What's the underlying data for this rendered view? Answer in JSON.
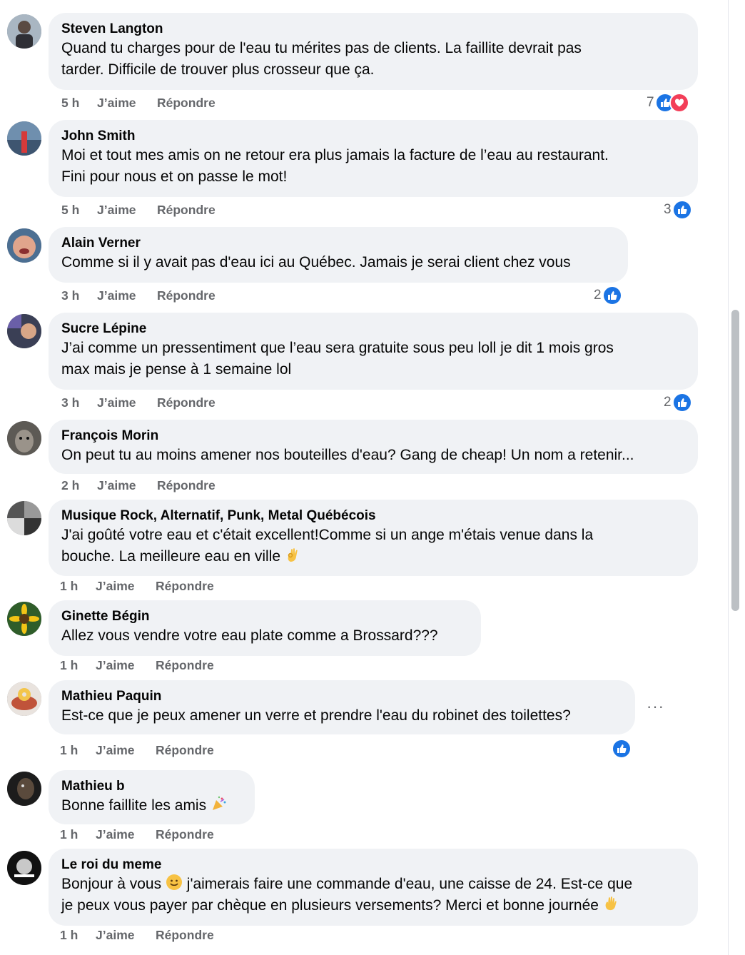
{
  "comments": [
    {
      "author": "Steven Langton",
      "lines": [
        "Quand tu charges pour de l'eau tu mérites pas de clients. La faillite devrait pas",
        "tarder. Difficile de trouver plus crosseur que ça."
      ],
      "time": "5 h",
      "like": "J’aime",
      "reply": "Répondre",
      "reaction_count": "7",
      "reactions": [
        "like",
        "love"
      ]
    },
    {
      "author": "John Smith",
      "lines": [
        "Moi et tout mes amis on ne retour era plus jamais la facture de l’eau au restaurant.",
        "Fini pour nous et on passe le mot!"
      ],
      "time": "5 h",
      "like": "J’aime",
      "reply": "Répondre",
      "reaction_count": "3",
      "reactions": [
        "like"
      ]
    },
    {
      "author": "Alain Verner",
      "lines": [
        "Comme si il y avait pas d'eau ici au Québec. Jamais je serai client chez vous"
      ],
      "time": "3 h",
      "like": "J’aime",
      "reply": "Répondre",
      "reaction_count": "2",
      "reactions": [
        "like"
      ]
    },
    {
      "author": "Sucre Lépine",
      "lines": [
        "J’ai comme un pressentiment que l’eau sera gratuite sous peu loll je dit 1 mois gros",
        "max mais je pense à 1 semaine lol"
      ],
      "time": "3 h",
      "like": "J’aime",
      "reply": "Répondre",
      "reaction_count": "2",
      "reactions": [
        "like"
      ]
    },
    {
      "author": "François Morin",
      "lines": [
        "On peut tu au moins amener nos bouteilles d'eau? Gang de cheap! Un nom a retenir..."
      ],
      "time": "2 h",
      "like": "J’aime",
      "reply": "Répondre",
      "reaction_count": "",
      "reactions": []
    },
    {
      "author": "Musique Rock, Alternatif, Punk, Metal Québécois",
      "lines": [
        "J'ai goûté votre eau et c'était excellent!Comme si un ange m'étais venue dans la",
        "bouche. La meilleure eau en ville"
      ],
      "time": "1 h",
      "like": "J’aime",
      "reply": "Répondre",
      "reaction_count": "",
      "reactions": []
    },
    {
      "author": "Ginette Bégin",
      "lines": [
        "Allez vous vendre votre eau plate comme a Brossard???"
      ],
      "time": "1 h",
      "like": "J’aime",
      "reply": "Répondre",
      "reaction_count": "",
      "reactions": []
    },
    {
      "author": "Mathieu Paquin",
      "lines": [
        "Est-ce que je peux amener un verre et prendre l'eau du robinet des toilettes?"
      ],
      "time": "1 h",
      "like": "J’aime",
      "reply": "Répondre",
      "reaction_count": "",
      "reactions": [
        "like"
      ],
      "more": "···"
    },
    {
      "author": "Mathieu b",
      "lines": [
        "Bonne faillite les amis"
      ],
      "time": "1 h",
      "like": "J’aime",
      "reply": "Répondre",
      "reaction_count": "",
      "reactions": []
    },
    {
      "author": "Le roi du meme",
      "lines": [
        "Bonjour à vous",
        "j'aimerais faire une commande d'eau, une caisse de 24. Est-ce que",
        "je peux vous payer par chèque en plusieurs versements? Merci et bonne journée"
      ],
      "time": "1 h",
      "like": "J’aime",
      "reply": "Répondre",
      "reaction_count": "",
      "reactions": []
    }
  ]
}
